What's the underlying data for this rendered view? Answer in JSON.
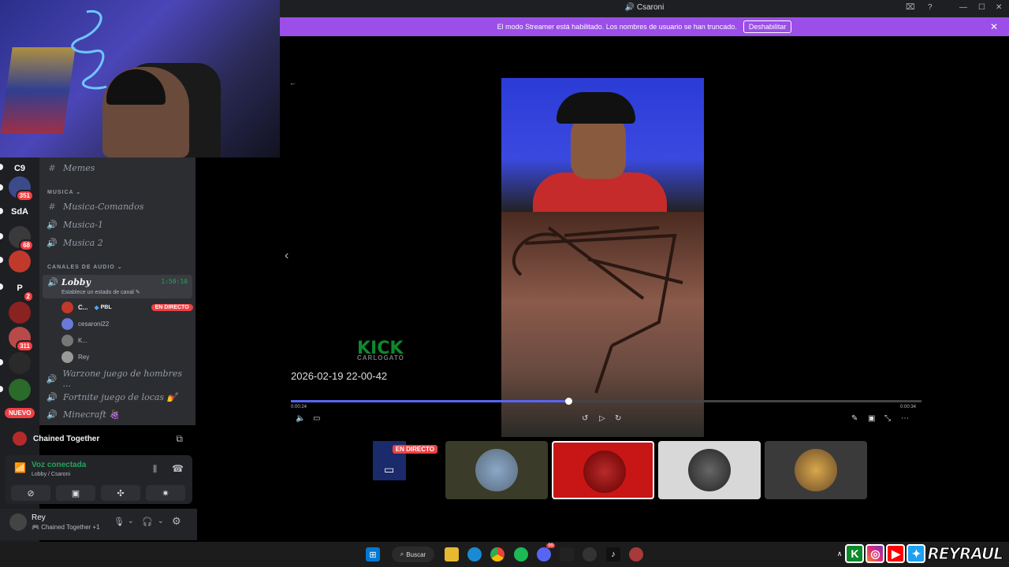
{
  "window": {
    "title": "Csaroni"
  },
  "banner": {
    "text": "El modo Streamer está habilitado. Los nombres de usuario se han truncado.",
    "button": "Deshabilitar"
  },
  "servers": [
    {
      "label": "C9"
    },
    {
      "label": "",
      "badge": "351"
    },
    {
      "label": "SdA"
    },
    {
      "label": "",
      "badge": "68"
    },
    {
      "label": ""
    },
    {
      "label": "P",
      "badge": "2"
    },
    {
      "label": ""
    },
    {
      "label": "",
      "badge": "311"
    },
    {
      "label": ""
    },
    {
      "label": ""
    }
  ],
  "nuevo_label": "NUEVO",
  "channels": {
    "memes": "Memes",
    "musica_category": "MUSICA",
    "musica_comandos": "Musica-Comandos",
    "musica1": "Musica-1",
    "musica2": "Musica 2",
    "audio_category": "CANALES DE AUDIO",
    "lobby": {
      "name": "Lobby",
      "timer": "1:50:10",
      "status": "Establece un estado de canal"
    },
    "members": [
      {
        "name": "C...",
        "tag": "PBL",
        "live": "EN DIRECTO"
      },
      {
        "name": "cesaroni22"
      },
      {
        "name": "K..."
      },
      {
        "name": "Rey"
      }
    ],
    "warzone": "Warzone juego de hombres ...",
    "fortnite": "Fortnite juego de locas 💅",
    "minecraft": "Minecraft 🍇"
  },
  "activity": {
    "title": "Chained Together"
  },
  "voice": {
    "status": "Voz conectada",
    "location": "Lobby / Csaroni"
  },
  "user": {
    "name": "Rey",
    "status": "Chained Together +1"
  },
  "player": {
    "datestamp": "2026-02-19 22-00-42",
    "time_current": "0:00:24",
    "time_total": "0:00:34",
    "progress": 0.44,
    "overlay_brand": "KICK",
    "overlay_sub": "CARLOGATO"
  },
  "thumbnails": {
    "live_label": "EN DIRECTO"
  },
  "taskbar": {
    "search": "Buscar",
    "discord_badge": "99"
  },
  "branding": {
    "name": "REYRAUL"
  }
}
